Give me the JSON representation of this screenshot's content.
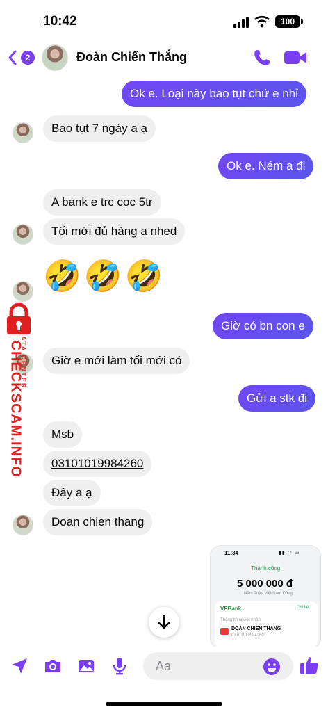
{
  "status_bar": {
    "time": "10:42",
    "battery": "100"
  },
  "header": {
    "back_badge": "2",
    "contact_name": "Đoàn Chiến Thắng",
    "accent": "#7b3ff2"
  },
  "messages": [
    {
      "side": "out",
      "text": "Ok e. Loại này bao tụt chứ e nhỉ"
    },
    {
      "side": "in",
      "text": "Bao tụt 7 ngày a ạ"
    },
    {
      "side": "out",
      "text": "Ok e. Ném a đi"
    },
    {
      "side": "in",
      "text": "A bank e trc cọc 5tr"
    },
    {
      "side": "in",
      "text": "Tối mới đủ hàng a nhed"
    },
    {
      "side": "in",
      "text": "🤣🤣🤣"
    },
    {
      "side": "out",
      "text": "Giờ có bn con e"
    },
    {
      "side": "in",
      "text": "Giờ e mới làm tối mới có"
    },
    {
      "side": "out",
      "text": "Gửi a stk đi"
    },
    {
      "side": "in",
      "text": "Msb"
    },
    {
      "side": "in",
      "text": "03101019984260"
    },
    {
      "side": "in",
      "text": "Đây a ạ"
    },
    {
      "side": "in",
      "text": "Doan chien thang"
    }
  ],
  "receipt": {
    "time": "11:34",
    "status": "Thành công",
    "amount": "5 000 000 đ",
    "amount_words": "Năm Triệu Việt Nam Đồng",
    "bank": "VPBank",
    "detail_link": "Chi tiết",
    "recipient_label": "Thông tin người nhận",
    "recipient_name": "DOAN CHIEN THANG",
    "recipient_account": "03101019984260"
  },
  "watermark": {
    "main": "CHECKSCAM.INFO",
    "sub": "DATA CENTER"
  },
  "composer": {
    "placeholder": "Aa"
  }
}
